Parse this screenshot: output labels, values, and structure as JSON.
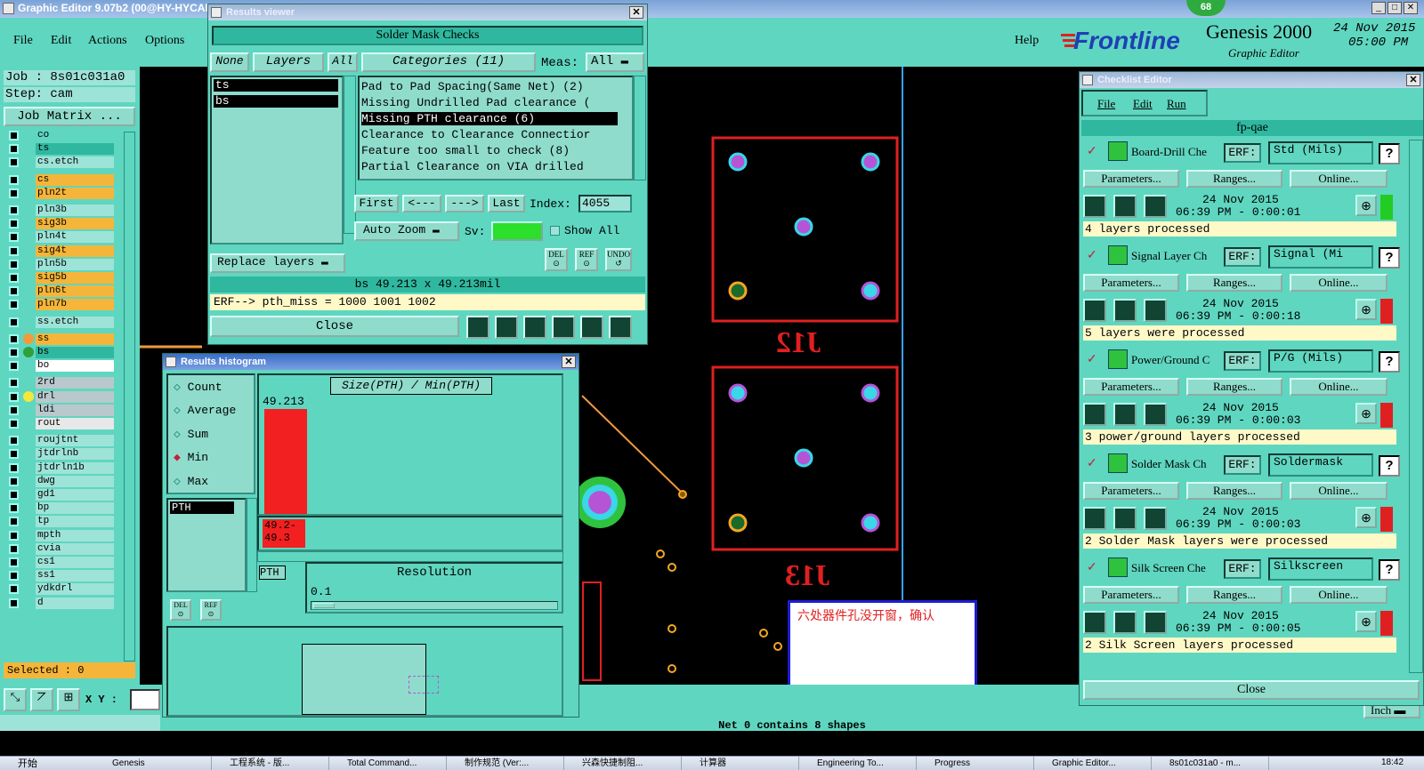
{
  "app": {
    "title": "Graphic Editor 9.07b2 (00@HY-HYCAM",
    "menu": [
      "File",
      "Edit",
      "Actions",
      "Options"
    ],
    "help": "Help",
    "brand": "Frontline",
    "product": "Genesis 2000",
    "subtitle": "Graphic Editor",
    "date": "24 Nov 2015",
    "time": "05:00 PM",
    "badge": "68"
  },
  "job": {
    "job_label": "Job : 8s01c031a0",
    "step_label": "Step: cam",
    "matrix_button": "Job Matrix ...",
    "selected": "Selected : 0",
    "xy_label": "X Y :"
  },
  "layers": [
    {
      "name": "co",
      "color": "#5fd6c0"
    },
    {
      "name": "ts",
      "color": "#2fb89f"
    },
    {
      "name": "cs.etch",
      "color": "#9ee3d8"
    },
    {
      "name": "cs",
      "color": "#f5b53a"
    },
    {
      "name": "pln2t",
      "color": "#f5b53a"
    },
    {
      "name": "pln3b",
      "color": "#9ee3d8"
    },
    {
      "name": "sig3b",
      "color": "#f5b53a"
    },
    {
      "name": "pln4t",
      "color": "#9ee3d8"
    },
    {
      "name": "sig4t",
      "color": "#f5b53a"
    },
    {
      "name": "pln5b",
      "color": "#9ee3d8"
    },
    {
      "name": "sig5b",
      "color": "#f5b53a"
    },
    {
      "name": "pln6t",
      "color": "#f5b53a"
    },
    {
      "name": "pln7b",
      "color": "#f5b53a"
    },
    {
      "name": "ss.etch",
      "color": "#9ee3d8"
    },
    {
      "name": "ss",
      "color": "#f5b53a"
    },
    {
      "name": "bs",
      "color": "#2fb89f"
    },
    {
      "name": "bo",
      "color": "#ffffff"
    },
    {
      "name": "2rd",
      "color": "#b9c8cc"
    },
    {
      "name": "drl",
      "color": "#b9c8cc"
    },
    {
      "name": "ldi",
      "color": "#b9c8cc"
    },
    {
      "name": "rout",
      "color": "#e8e8e8"
    },
    {
      "name": "roujtnt",
      "color": "#9ee3d8"
    },
    {
      "name": "jtdrlnb",
      "color": "#9ee3d8"
    },
    {
      "name": "jtdrln1b",
      "color": "#9ee3d8"
    },
    {
      "name": "dwg",
      "color": "#9ee3d8"
    },
    {
      "name": "gd1",
      "color": "#9ee3d8"
    },
    {
      "name": "bp",
      "color": "#9ee3d8"
    },
    {
      "name": "tp",
      "color": "#9ee3d8"
    },
    {
      "name": "mpth",
      "color": "#9ee3d8"
    },
    {
      "name": "cvia",
      "color": "#9ee3d8"
    },
    {
      "name": "cs1",
      "color": "#9ee3d8"
    },
    {
      "name": "ss1",
      "color": "#9ee3d8"
    },
    {
      "name": "ydkdrl",
      "color": "#9ee3d8"
    },
    {
      "name": "d",
      "color": "#9ee3d8"
    }
  ],
  "results": {
    "window_title": "Results viewer",
    "header": "Solder Mask Checks",
    "none": "None",
    "layers": "Layers",
    "all": "All",
    "categories": "Categories (11)",
    "meas": "Meas:",
    "meas_value": "All",
    "layer_list": [
      "ts",
      "bs"
    ],
    "category_list": [
      "Pad to Pad Spacing(Same Net) (2)",
      "Missing Undrilled Pad clearance (",
      "Missing PTH clearance (6)",
      "Clearance to Clearance Connectior",
      "Feature too small to check (8)",
      "Partial Clearance on VIA drilled"
    ],
    "first": "First",
    "prev": "<---",
    "next": "--->",
    "last": "Last",
    "index_label": "Index:",
    "index_value": "4055",
    "auto_zoom": "Auto Zoom",
    "sv": "Sv:",
    "show_all": "Show All",
    "replace_layers": "Replace layers",
    "del": "DEL",
    "ref": "REF",
    "undo": "UNDO",
    "size_info": "bs 49.213 x 49.213mil",
    "erf_info": "ERF--> pth_miss = 1000 1001 1002",
    "close": "Close"
  },
  "histogram": {
    "window_title": "Results histogram",
    "options": [
      "Count",
      "Average",
      "Sum",
      "Min",
      "Max"
    ],
    "selected": "Min",
    "header": "Size(PTH) / Min(PTH)",
    "value_label": "49.213",
    "bin_label_1": "49.2-",
    "bin_label_2": "49.3",
    "list_item": "PTH",
    "pth_small": "PTH",
    "resolution_label": "Resolution",
    "resolution_value": "0.1",
    "del": "DEL",
    "ref": "REF"
  },
  "checklist": {
    "window_title": "Checklist Editor",
    "menu": [
      "File",
      "Edit",
      "Run"
    ],
    "name": "fp-qae",
    "parameters": "Parameters...",
    "ranges": "Ranges...",
    "online": "Online...",
    "erf_label": "ERF:",
    "question": "?",
    "close": "Close",
    "actions": [
      {
        "name": "Board-Drill Che",
        "erf": "Std (Mils)",
        "date": "24 Nov 2015",
        "time": "06:39 PM - 0:00:01",
        "status": "4 layers processed",
        "state_color": "#22cc22"
      },
      {
        "name": "Signal Layer Ch",
        "erf": "Signal (Mi",
        "date": "24 Nov 2015",
        "time": "06:39 PM - 0:00:18",
        "status": "5 layers were processed",
        "state_color": "#e02020"
      },
      {
        "name": "Power/Ground C",
        "erf": "P/G (Mils)",
        "date": "24 Nov 2015",
        "time": "06:39 PM - 0:00:03",
        "status": "3 power/ground layers processed",
        "state_color": "#e02020"
      },
      {
        "name": "Solder Mask Ch",
        "erf": "Soldermask",
        "date": "24 Nov 2015",
        "time": "06:39 PM - 0:00:03",
        "status": "2 Solder Mask layers were processed",
        "state_color": "#e02020"
      },
      {
        "name": "Silk Screen Che",
        "erf": "Silkscreen",
        "date": "24 Nov 2015",
        "time": "06:39 PM - 0:00:05",
        "status": "2 Silk Screen layers processed",
        "state_color": "#e02020"
      }
    ]
  },
  "canvas": {
    "j12": "J12",
    "j13": "J13",
    "annotation": "六处器件孔没开窗，确认",
    "status": "Net 0 contains 8 shapes",
    "unit": "Inch"
  },
  "taskbar": {
    "start": "开始",
    "items": [
      "Genesis",
      "工程系统 - 版...",
      "Total Command...",
      "制作规范 (Ver:...",
      "兴森快捷制阻...",
      "计算器",
      "Engineering To...",
      "Progress",
      "Graphic Editor...",
      "8s01c031a0 - m..."
    ],
    "clock": "18:42"
  }
}
